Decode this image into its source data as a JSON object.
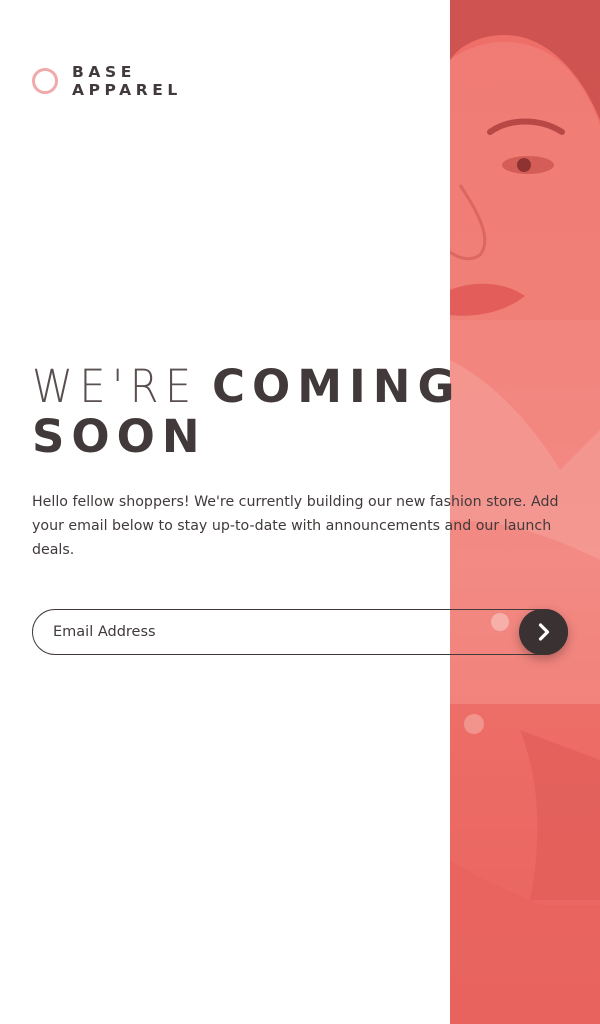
{
  "brand": {
    "line1": "BASE",
    "line2": "APPAREL"
  },
  "heading": {
    "light": "WE'RE ",
    "bold_1": "COMING",
    "bold_2": "SOON"
  },
  "intro": "Hello fellow shoppers! We're currently building our new fashion store. Add your email below to stay up-to-date with announcements and our launch deals.",
  "form": {
    "email_placeholder": "Email Address",
    "email_value": "",
    "submit_icon": "chevron-right-icon"
  },
  "hero": {
    "description_icon": "hero-image"
  },
  "colors": {
    "accent": "#f2a9a9",
    "text": "#423a3a",
    "hero_tint": "#ef6d67",
    "button": "#3a3232"
  }
}
